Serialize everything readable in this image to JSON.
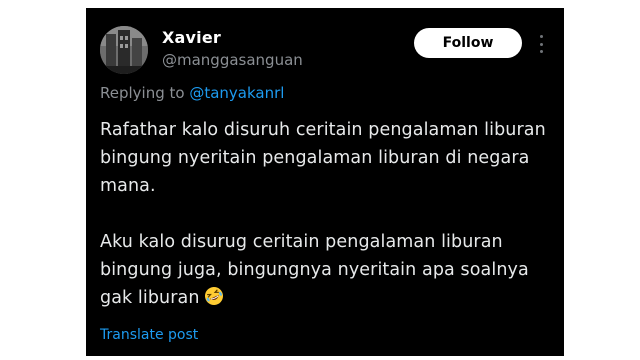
{
  "post": {
    "author": {
      "display_name": "Xavier",
      "handle": "@manggasanguan"
    },
    "follow_label": "Follow",
    "reply_prefix": "Replying to ",
    "reply_to": "@tanyakanrl",
    "paragraphs": [
      "Rafathar kalo disuruh ceritain pengalaman liburan bingung nyeritain pengalaman liburan di negara mana.",
      "Aku kalo disurug ceritain pengalaman liburan bingung juga, bingungnya nyeritain apa soalnya gak liburan"
    ],
    "emoji": "rolling-on-floor-laughing",
    "translate_label": "Translate post"
  },
  "colors": {
    "background": "#000000",
    "text": "#e7e9ea",
    "muted": "#8b8f94",
    "link": "#1d9bf0",
    "button_bg": "#ffffff"
  }
}
